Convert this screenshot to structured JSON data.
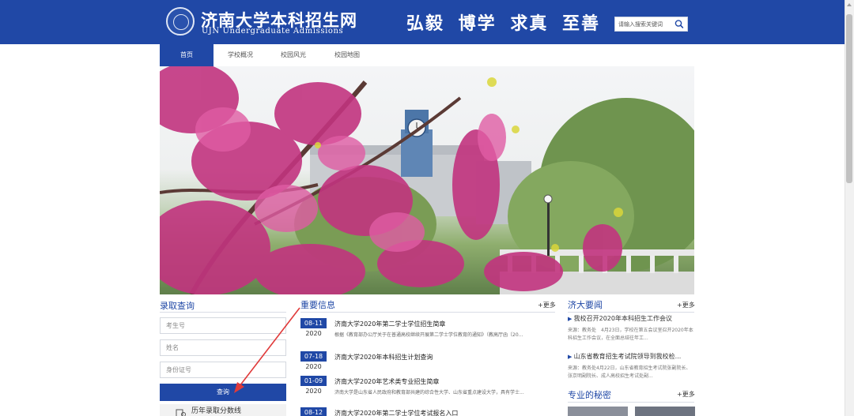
{
  "header": {
    "logo_cn": "济南大学本科招生网",
    "logo_en": "UJN Undergraduate Admissions",
    "motto": "弘毅 博学 求真 至善",
    "search_placeholder": "请输入搜索关键词",
    "search_icon": "search-icon"
  },
  "nav": {
    "items": [
      {
        "label": "首页",
        "active": true
      },
      {
        "label": "学校概况",
        "active": false
      },
      {
        "label": "校园风光",
        "active": false
      },
      {
        "label": "校园地图",
        "active": false
      }
    ]
  },
  "banner": {
    "description": "campus photo: clock tower behind blooming redbud trees and willows"
  },
  "admission_query": {
    "title": "录取查询",
    "fields": [
      {
        "placeholder": "考生号"
      },
      {
        "placeholder": "姓名"
      },
      {
        "placeholder": "身份证号"
      }
    ],
    "query_button": "查询",
    "history_link": "历年录取分数线"
  },
  "important_news": {
    "title": "重要信息",
    "more": "+更多",
    "items": [
      {
        "md": "08-11",
        "year": "2020",
        "title": "济南大学2020年第二学士学位招生简章",
        "desc": "根据《教育部办公厅关于在普通高校继续开展第二学士学位教育的通知》（教高厅函〔20..."
      },
      {
        "md": "07-18",
        "year": "2020",
        "title": "济南大学2020年本科招生计划查询",
        "desc": ""
      },
      {
        "md": "01-09",
        "year": "2020",
        "title": "济南大学2020年艺术类专业招生简章",
        "desc": "济南大学是山东省人民政府和教育部共建的综合性大学、山东省重点建设大学，具有学士..."
      },
      {
        "md": "08-12",
        "year": "",
        "title": "济南大学2020年第二学士学位考试报名入口",
        "desc": ""
      }
    ]
  },
  "jida_news": {
    "title": "济大要闻",
    "more": "+更多",
    "items": [
      {
        "title": "我校召开2020年本科招生工作会议",
        "desc": "来源：教务处　4月23日，学校在第五会议室召开2020年本科招生工作会议，在全面总结往年工..."
      },
      {
        "title": "山东省教育招生考试院领导到我校检...",
        "desc": "来源：教务处4月22日，山东省教育招生考试院张副院长、张京明副院长、成人高校招生考试处副..."
      }
    ]
  },
  "majors": {
    "title": "专业的秘密",
    "more": "+更多"
  },
  "colors": {
    "brand": "#2048a6",
    "annotation_arrow": "#e03a3a"
  }
}
